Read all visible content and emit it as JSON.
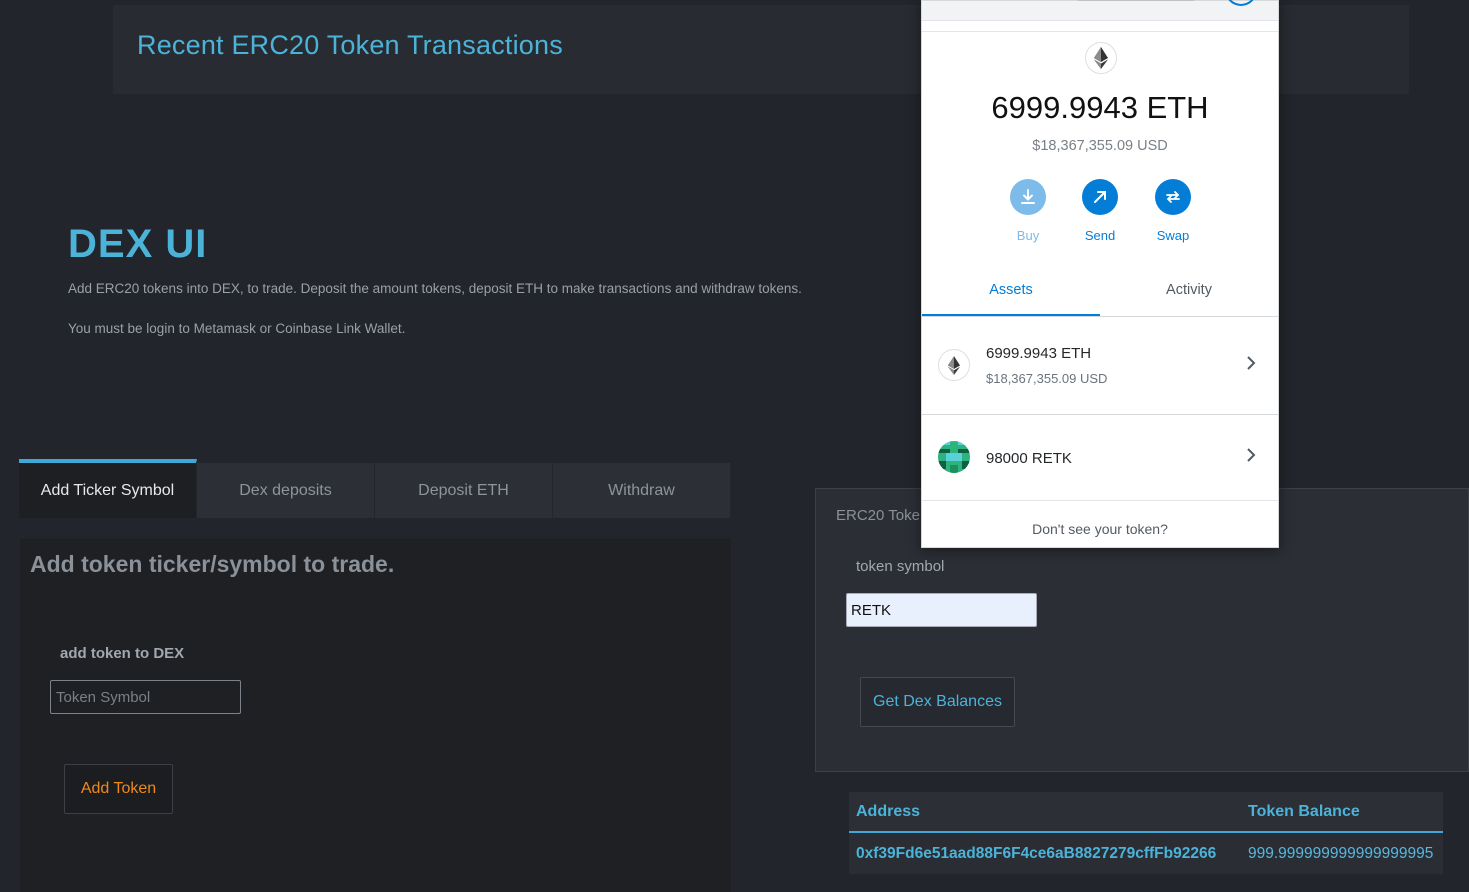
{
  "header": {
    "recent_title": "Recent ERC20 Token Transactions"
  },
  "hero": {
    "title": "DEX UI",
    "description": "Add ERC20 tokens into DEX, to trade. Deposit the amount tokens, deposit ETH to make transactions and withdraw tokens.",
    "login_note": "You must be login to Metamask or Coinbase Link Wallet."
  },
  "tabs": [
    {
      "label": "Add Ticker Symbol",
      "active": true
    },
    {
      "label": "Dex deposits",
      "active": false
    },
    {
      "label": "Deposit ETH",
      "active": false
    },
    {
      "label": "Withdraw",
      "active": false
    }
  ],
  "add_panel": {
    "heading": "Add token ticker/symbol to trade.",
    "field_label": "add token to DEX",
    "input_placeholder": "Token Symbol",
    "input_value": "",
    "button_label": "Add Token"
  },
  "balances_panel": {
    "title_partial": "ERC20 Toke",
    "field_label": "token symbol",
    "input_value": "RETK",
    "button_label": "Get Dex Balances",
    "table": {
      "columns": [
        "Address",
        "Token Balance"
      ],
      "rows": [
        [
          "0xf39Fd6e51aad88F6F4ce6aB8827279cffFb92266",
          "999.999999999999999995"
        ]
      ]
    }
  },
  "metamask": {
    "balance": "6999.9943 ETH",
    "balance_usd": "$18,367,355.09 USD",
    "actions": [
      {
        "label": "Buy",
        "icon": "download-icon"
      },
      {
        "label": "Send",
        "icon": "arrow-up-right-icon"
      },
      {
        "label": "Swap",
        "icon": "swap-icon"
      }
    ],
    "tabs": [
      {
        "label": "Assets",
        "active": true
      },
      {
        "label": "Activity",
        "active": false
      }
    ],
    "assets": [
      {
        "name": "6999.9943 ETH",
        "sub": "$18,367,355.09 USD",
        "icon": "ethereum-icon"
      },
      {
        "name": "98000 RETK",
        "icon": "retk-token-icon"
      }
    ],
    "dont_see": "Don't see your token?",
    "colors": {
      "primary": "#037dd6",
      "primary_disabled": "#7cbbea"
    }
  },
  "colors": {
    "page_bg": "#22252b",
    "accent": "#4cb3d8",
    "add_button_text": "#f0891c"
  }
}
